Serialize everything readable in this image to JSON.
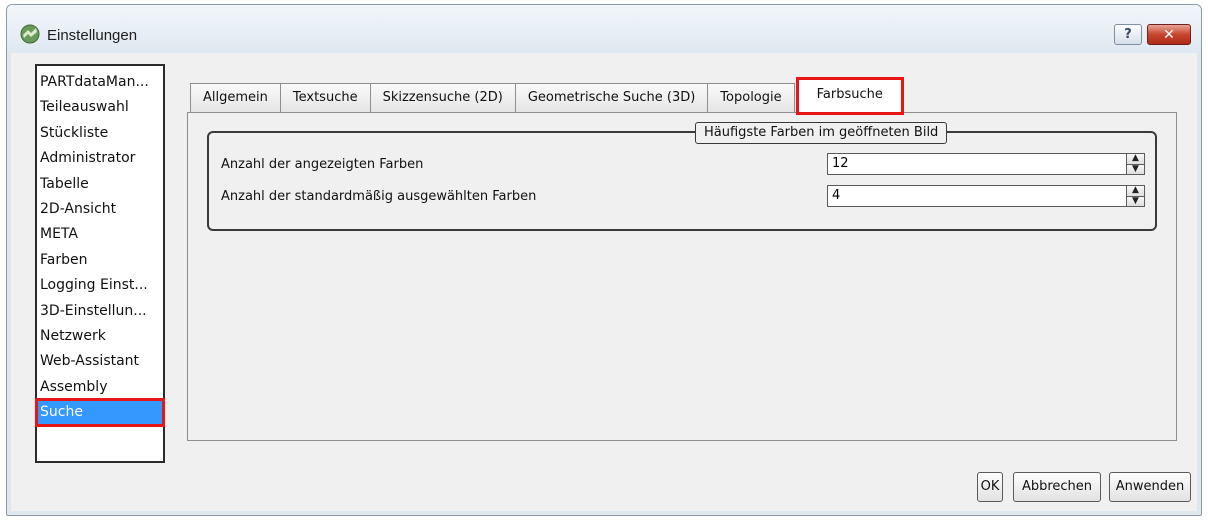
{
  "window": {
    "title": "Einstellungen",
    "help_label": "?",
    "close_label": "✕"
  },
  "sidebar": {
    "items": [
      {
        "label": "PARTdataMan..."
      },
      {
        "label": "Teileauswahl"
      },
      {
        "label": "Stückliste"
      },
      {
        "label": "Administrator"
      },
      {
        "label": "Tabelle"
      },
      {
        "label": "2D-Ansicht"
      },
      {
        "label": "META"
      },
      {
        "label": "Farben"
      },
      {
        "label": "Logging Einst..."
      },
      {
        "label": "3D-Einstellun..."
      },
      {
        "label": "Netzwerk"
      },
      {
        "label": "Web-Assistant"
      },
      {
        "label": "Assembly"
      },
      {
        "label": "Suche",
        "selected": true
      }
    ]
  },
  "tabs": [
    {
      "label": "Allgemein"
    },
    {
      "label": "Textsuche"
    },
    {
      "label": "Skizzensuche (2D)"
    },
    {
      "label": "Geometrische Suche (3D)"
    },
    {
      "label": "Topologie"
    },
    {
      "label": "Farbsuche",
      "active": true
    }
  ],
  "panel": {
    "group_title": "Häufigste Farben im geöffneten Bild",
    "fields": [
      {
        "label": "Anzahl der angezeigten Farben",
        "value": "12"
      },
      {
        "label": "Anzahl der standardmäßig ausgewählten Farben",
        "value": "4"
      }
    ]
  },
  "buttons": {
    "ok": "OK",
    "cancel": "Abbrechen",
    "apply": "Anwenden"
  },
  "colors": {
    "highlight": "#e81717",
    "selection": "#3399ff"
  }
}
